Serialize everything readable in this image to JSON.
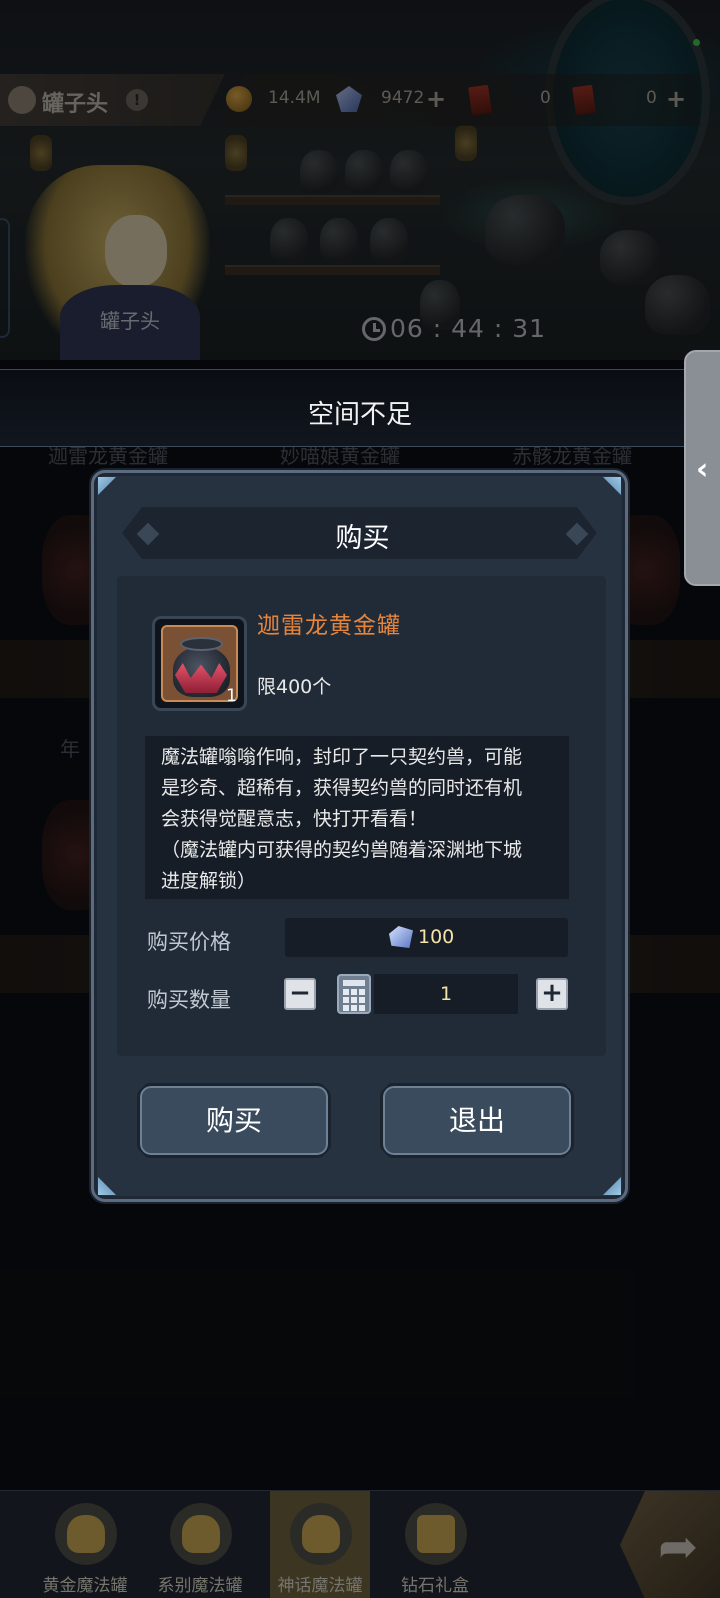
{
  "top_bar": {
    "player_name": "罐子头",
    "info_icon": "!",
    "gold": "14.4M",
    "diamonds": "9472",
    "ticket_a": "0",
    "ticket_b": "0",
    "plus_icon": "+"
  },
  "scene": {
    "npc_name": "罐子头",
    "timer": "06 : 44 : 31"
  },
  "toast": {
    "message": "空间不足"
  },
  "background_list": {
    "row_titles": [
      "迦雷龙黄金罐",
      "妙喵娘黄金罐",
      "赤骸龙黄金罐"
    ],
    "row2_title": "年"
  },
  "side_handle": {
    "icon": "‹"
  },
  "dialog": {
    "title": "购买",
    "item_name": "迦雷龙黄金罐",
    "item_count": "1",
    "limit": "限400个",
    "description": "魔法罐嗡嗡作响，封印了一只契约兽，可能\n是珍奇、超稀有，获得契约兽的同时还有机\n会获得觉醒意志，快打开看看！\n（魔法罐内可获得的契约兽随着深渊地下城\n进度解锁）",
    "price_label": "购买价格",
    "price_value": "100",
    "quantity_label": "购买数量",
    "quantity_value": "1",
    "minus_icon": "−",
    "plus_icon": "+",
    "buy_button": "购买",
    "exit_button": "退出"
  },
  "bottom_nav": {
    "items": [
      {
        "label": "黄金魔法罐"
      },
      {
        "label": "系别魔法罐"
      },
      {
        "label": "神话魔法罐"
      },
      {
        "label": "钻石礼盒"
      }
    ],
    "active_index": 2,
    "arrow_icon": "➦"
  },
  "colors": {
    "item_name": "#e6843c",
    "dialog_bg": "#273241",
    "price_text": "#f4e3a8",
    "online_dot": "#3fbf50"
  }
}
